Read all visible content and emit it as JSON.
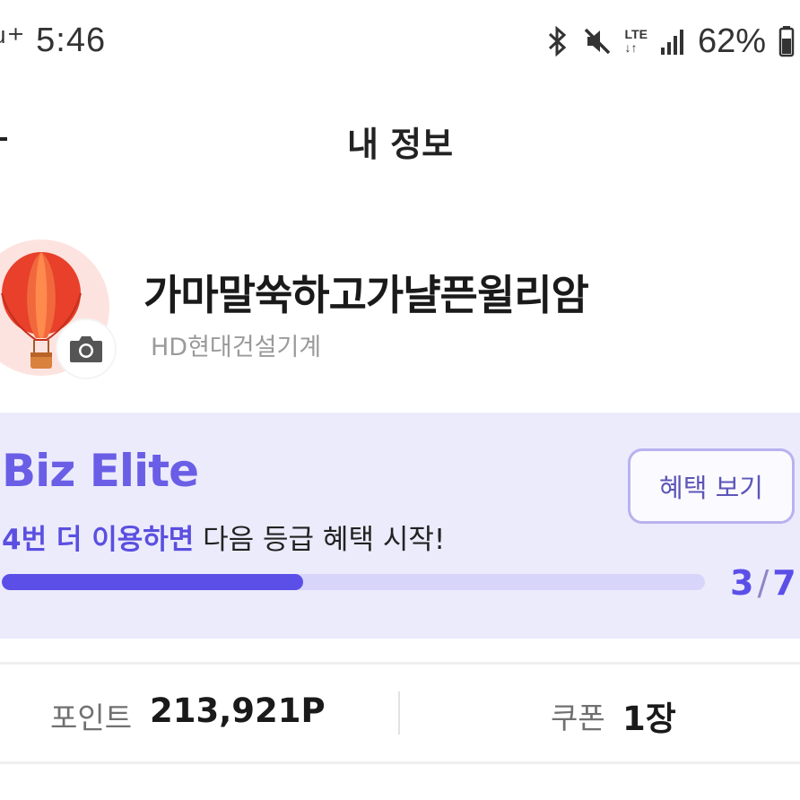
{
  "status_bar": {
    "time": "ᵘ⁺ 5:46",
    "battery": "62%",
    "icons": [
      "bluetooth-icon",
      "mute-icon",
      "lte-icon",
      "signal-icon",
      "battery-icon"
    ],
    "lte_label": "LTE"
  },
  "header": {
    "title": "내 정보",
    "back_icon": "back-arrow-icon"
  },
  "profile": {
    "name": "가마말쑥하고가냘픈윌리암",
    "company": "HD현대건설기계",
    "avatar_icon": "hot-air-balloon-icon",
    "camera_icon": "camera-icon"
  },
  "grade": {
    "title": "Biz Elite",
    "benefit_button": "혜택 보기",
    "message_highlight": "4번 더 이용하면",
    "message_rest": " 다음 등급 혜택 시작!",
    "progress_current": "3",
    "progress_total": "7",
    "progress_fraction": 0.428
  },
  "stats": {
    "points_label": "포인트",
    "points_value": "213,921P",
    "coupon_label": "쿠폰",
    "coupon_value": "1장"
  },
  "colors": {
    "accent": "#5b4fe8",
    "card_bg": "#ecebfc",
    "track": "#d8d5fb"
  }
}
